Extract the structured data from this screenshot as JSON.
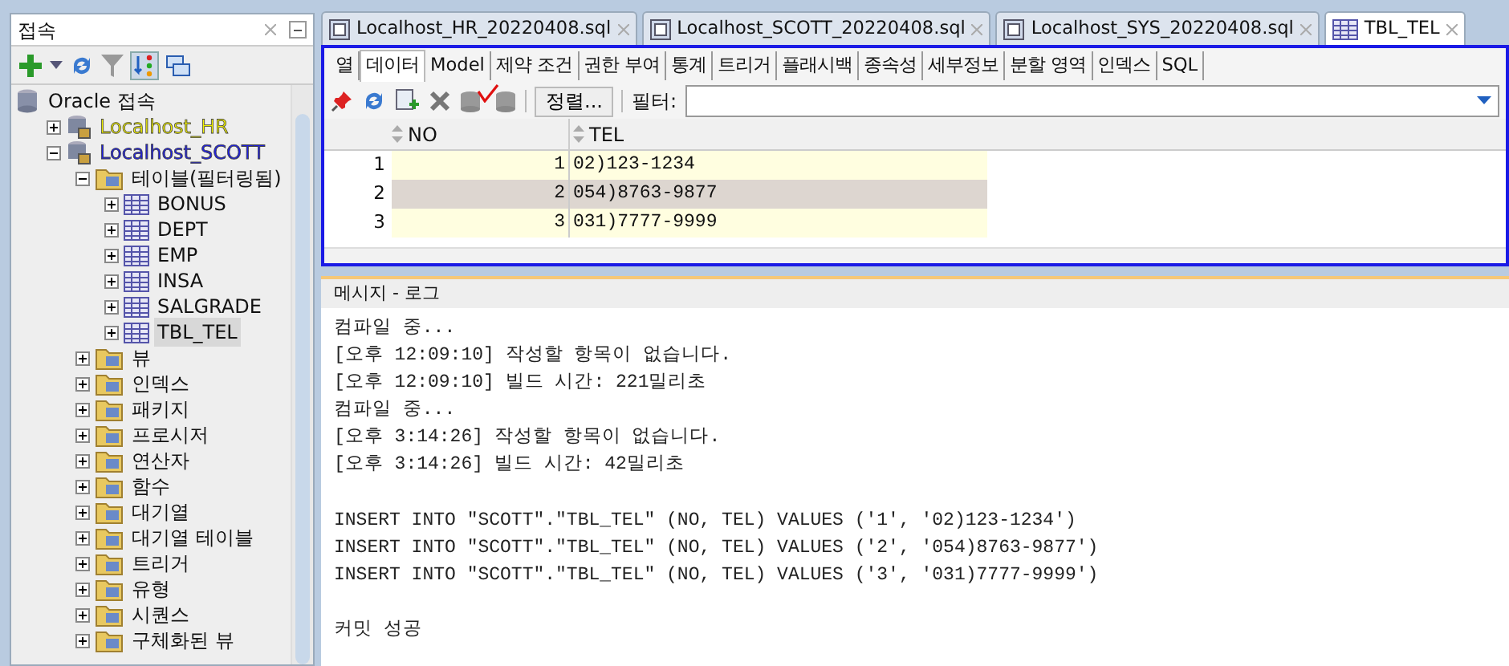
{
  "connections_panel": {
    "title": "접속",
    "tree": [
      {
        "label": "Oracle 접속",
        "kind": "root",
        "selected": false,
        "children": [
          {
            "label": "Localhost_HR",
            "kind": "connection",
            "color": "#f0f000",
            "expanded": false,
            "selected": false
          },
          {
            "label": "Localhost_SCOTT",
            "kind": "connection",
            "color": "#2020e0",
            "expanded": true,
            "selected": false,
            "children": [
              {
                "label": "테이블(필터링됨)",
                "kind": "folder",
                "expanded": true,
                "selected": false,
                "children": [
                  {
                    "label": "BONUS",
                    "kind": "table",
                    "expanded": false,
                    "selected": false
                  },
                  {
                    "label": "DEPT",
                    "kind": "table",
                    "expanded": false,
                    "selected": false
                  },
                  {
                    "label": "EMP",
                    "kind": "table",
                    "expanded": false,
                    "selected": false
                  },
                  {
                    "label": "INSA",
                    "kind": "table",
                    "expanded": false,
                    "selected": false
                  },
                  {
                    "label": "SALGRADE",
                    "kind": "table",
                    "expanded": false,
                    "selected": false
                  },
                  {
                    "label": "TBL_TEL",
                    "kind": "table",
                    "expanded": false,
                    "selected": true
                  }
                ]
              },
              {
                "label": "뷰",
                "kind": "folder",
                "expanded": false,
                "selected": false
              },
              {
                "label": "인덱스",
                "kind": "folder",
                "expanded": false,
                "selected": false
              },
              {
                "label": "패키지",
                "kind": "folder",
                "expanded": false,
                "selected": false
              },
              {
                "label": "프로시저",
                "kind": "folder",
                "expanded": false,
                "selected": false
              },
              {
                "label": "연산자",
                "kind": "folder",
                "expanded": false,
                "selected": false
              },
              {
                "label": "함수",
                "kind": "folder",
                "expanded": false,
                "selected": false
              },
              {
                "label": "대기열",
                "kind": "folder",
                "expanded": false,
                "selected": false
              },
              {
                "label": "대기열 테이블",
                "kind": "folder",
                "expanded": false,
                "selected": false
              },
              {
                "label": "트리거",
                "kind": "folder",
                "expanded": false,
                "selected": false
              },
              {
                "label": "유형",
                "kind": "folder",
                "expanded": false,
                "selected": false
              },
              {
                "label": "시퀀스",
                "kind": "folder",
                "expanded": false,
                "selected": false
              },
              {
                "label": "구체화된 뷰",
                "kind": "folder",
                "expanded": false,
                "selected": false
              }
            ]
          }
        ]
      }
    ]
  },
  "editor_tabs": [
    {
      "label": "Localhost_HR_20220408.sql",
      "kind": "sql",
      "selected": false
    },
    {
      "label": "Localhost_SCOTT_20220408.sql",
      "kind": "sql",
      "selected": false
    },
    {
      "label": "Localhost_SYS_20220408.sql",
      "kind": "sql",
      "selected": false
    },
    {
      "label": "TBL_TEL",
      "kind": "table",
      "selected": true
    }
  ],
  "object_tabs": [
    {
      "label": "열",
      "selected": false
    },
    {
      "label": "데이터",
      "selected": true
    },
    {
      "label": "Model",
      "selected": false
    },
    {
      "label": "제약 조건",
      "selected": false
    },
    {
      "label": "권한 부여",
      "selected": false
    },
    {
      "label": "통계",
      "selected": false
    },
    {
      "label": "트리거",
      "selected": false
    },
    {
      "label": "플래시백",
      "selected": false
    },
    {
      "label": "종속성",
      "selected": false
    },
    {
      "label": "세부정보",
      "selected": false
    },
    {
      "label": "분할 영역",
      "selected": false
    },
    {
      "label": "인덱스",
      "selected": false
    },
    {
      "label": "SQL",
      "selected": false
    }
  ],
  "data_toolbar": {
    "sort_button": "정렬...",
    "filter_label": "필터:"
  },
  "grid": {
    "columns": [
      "NO",
      "TEL"
    ],
    "rows": [
      {
        "row_number": "1",
        "no": "1",
        "tel": "02)123-1234",
        "selected": false
      },
      {
        "row_number": "2",
        "no": "2",
        "tel": "054)8763-9877",
        "selected": true
      },
      {
        "row_number": "3",
        "no": "3",
        "tel": "031)7777-9999",
        "selected": false
      }
    ]
  },
  "message_log": {
    "title": "메시지 - 로그",
    "blocks": [
      {
        "lines": [
          "컴파일 중...",
          "[오후 12:09:10] 작성할 항목이 없습니다.",
          "[오후 12:09:10] 빌드 시간: 221밀리초",
          "컴파일 중...",
          "[오후 3:14:26] 작성할 항목이 없습니다.",
          "[오후 3:14:26] 빌드 시간: 42밀리초"
        ]
      },
      {
        "lines": [
          "INSERT INTO \"SCOTT\".\"TBL_TEL\" (NO, TEL) VALUES ('1', '02)123-1234')",
          "INSERT INTO \"SCOTT\".\"TBL_TEL\" (NO, TEL) VALUES ('2', '054)8763-9877')",
          "INSERT INTO \"SCOTT\".\"TBL_TEL\" (NO, TEL) VALUES ('3', '031)7777-9999')"
        ]
      },
      {
        "lines": [
          "커밋 성공"
        ]
      }
    ]
  }
}
